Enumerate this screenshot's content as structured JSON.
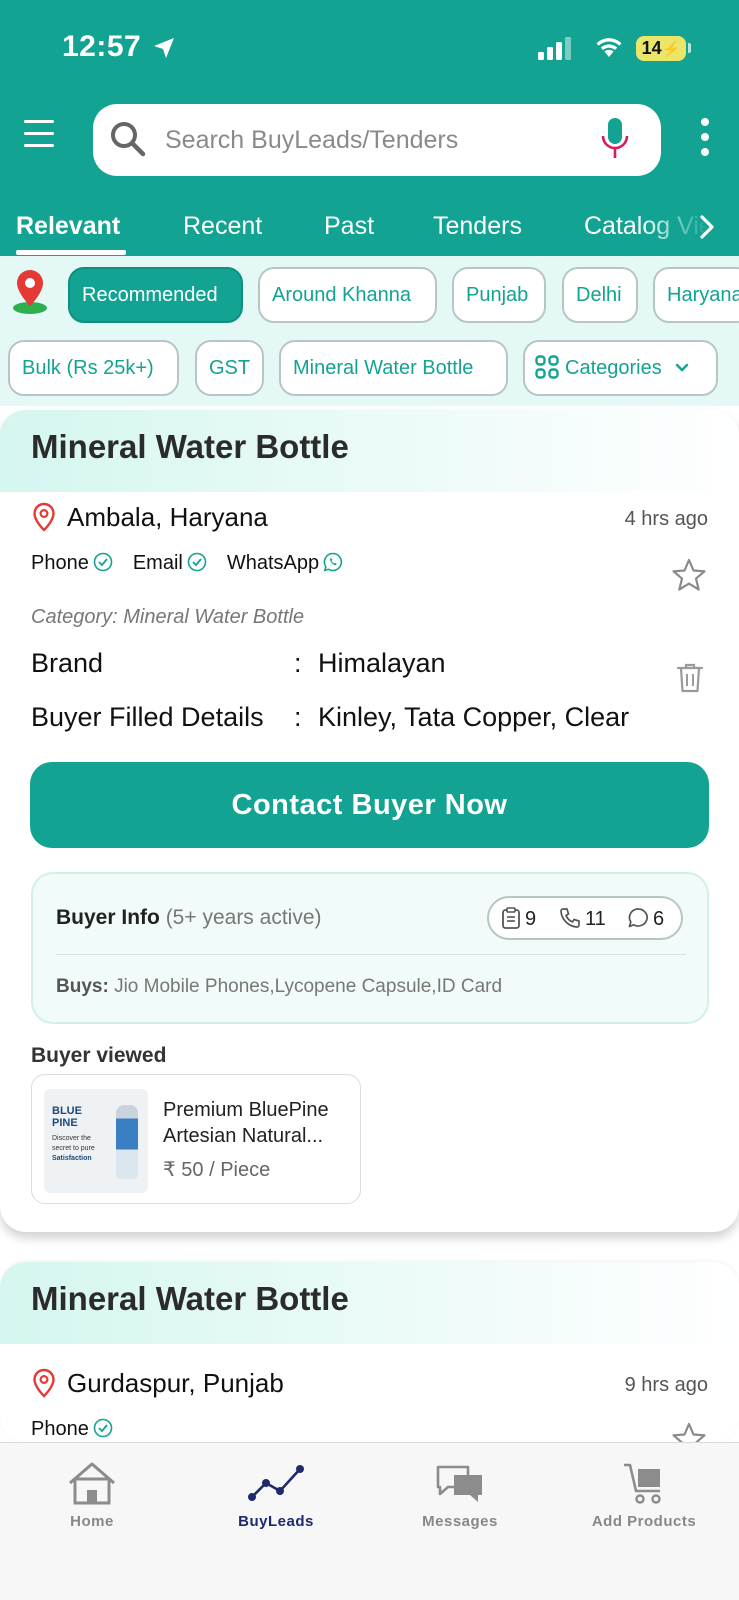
{
  "status_bar": {
    "time": "12:57",
    "battery": "14",
    "icons": [
      "location-arrow-icon",
      "signal-icon",
      "wifi-icon",
      "battery-charging-icon"
    ]
  },
  "header": {
    "search_placeholder": "Search BuyLeads/Tenders",
    "colors": {
      "brand": "#13a393",
      "mic": "#d81b60"
    }
  },
  "tabs": [
    {
      "label": "Relevant",
      "active": true
    },
    {
      "label": "Recent"
    },
    {
      "label": "Past"
    },
    {
      "label": "Tenders"
    },
    {
      "label": "Catalog Views"
    }
  ],
  "filters": {
    "location_chips": [
      "Recommended",
      "Around Khanna",
      "Punjab",
      "Delhi",
      "Haryana"
    ],
    "selected": "Recommended",
    "other_chips": [
      "Bulk (Rs 25k+)",
      "GST",
      "Mineral Water Bottle"
    ],
    "categories_label": "Categories"
  },
  "leads": [
    {
      "title": "Mineral Water Bottle",
      "location": "Ambala, Haryana",
      "time_ago": "4 hrs ago",
      "contacts": [
        "Phone",
        "Email",
        "WhatsApp"
      ],
      "category": "Category: Mineral Water Bottle",
      "details": [
        {
          "label": "Brand",
          "value": "Himalayan"
        },
        {
          "label": "Buyer Filled Details",
          "value": "Kinley, Tata Copper, Clear"
        }
      ],
      "cta": "Contact Buyer Now",
      "buyer_info": {
        "title": "Buyer Info",
        "subtitle": "(5+ years active)",
        "stats": {
          "requirements": "9",
          "calls": "11",
          "messages": "6"
        },
        "buys_label": "Buys:",
        "buys": "Jio Mobile Phones,Lycopene Capsule,ID Card"
      },
      "viewed_label": "Buyer viewed",
      "viewed_product": {
        "name": "Premium BluePine Artesian Natural...",
        "price": "₹ 50 / Piece",
        "thumb_brand": "BLUE PINE",
        "thumb_lines": [
          "Discover the",
          "secret to pure",
          "Satisfaction"
        ]
      }
    },
    {
      "title": "Mineral Water Bottle",
      "location": "Gurdaspur, Punjab",
      "time_ago": "9 hrs ago",
      "contacts": [
        "Phone"
      ]
    }
  ],
  "bottom_nav": [
    {
      "label": "Home",
      "icon": "home-icon"
    },
    {
      "label": "BuyLeads",
      "icon": "buyleads-graph-icon",
      "active": true
    },
    {
      "label": "Messages",
      "icon": "messages-icon"
    },
    {
      "label": "Add Products",
      "icon": "cart-icon"
    }
  ]
}
